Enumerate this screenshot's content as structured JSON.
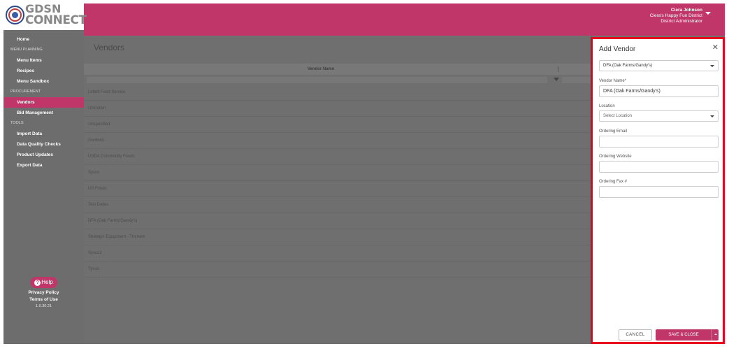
{
  "colors": {
    "brand": "#c03669",
    "highlight_border": "#e8001e",
    "overlay": "#6f6f6f"
  },
  "logo": {
    "line1": "GDSN",
    "line2": "CONNECT"
  },
  "user": {
    "name": "Ciera Johnson",
    "district": "Ciera's Happy Fun District",
    "role": "District Administrator"
  },
  "sidebar": {
    "home": "Home",
    "menu_planning": "MENU PLANNING",
    "menu_items": "Menu Items",
    "recipes": "Recipes",
    "menu_sandbox": "Menu Sandbox",
    "procurement": "PROCUREMENT",
    "vendors": "Vendors",
    "bid_management": "Bid Management",
    "tools": "TOOLS",
    "import_data": "Import Data",
    "data_quality_checks": "Data Quality Checks",
    "product_updates": "Product Updates",
    "export_data": "Export Data",
    "help": "Help",
    "privacy_policy": "Privacy Policy",
    "terms_of_use": "Terms of Use",
    "version": "1.0.30.21"
  },
  "main": {
    "page_title": "Vendors",
    "column_header": "Vendor Name",
    "rows": [
      "Lebelt Food Service",
      "Unknown",
      "Unspecified",
      "Gordons",
      "USDA Commodity Foods",
      "Sysco",
      "US Foods",
      "Test Dallas",
      "DFA (Oak Farms/Gandy's)",
      "Strategic Equipment - Tromark",
      "Sysco2",
      "Tyson"
    ]
  },
  "modal": {
    "title": "Add Vendor",
    "vendor_select_value": "DFA (Oak Farms/Gandy's)",
    "vendor_name_label": "Vendor Name*",
    "vendor_name_value": "DFA (Oak Farms/Gandy's)",
    "location_label": "Location",
    "location_placeholder": "Select Location",
    "ordering_email_label": "Ordering Email",
    "ordering_email_value": "",
    "ordering_website_label": "Ordering Website",
    "ordering_website_value": "",
    "ordering_fax_label": "Ordering Fax #",
    "ordering_fax_value": "",
    "cancel_label": "CANCEL",
    "save_label": "SAVE & CLOSE"
  }
}
